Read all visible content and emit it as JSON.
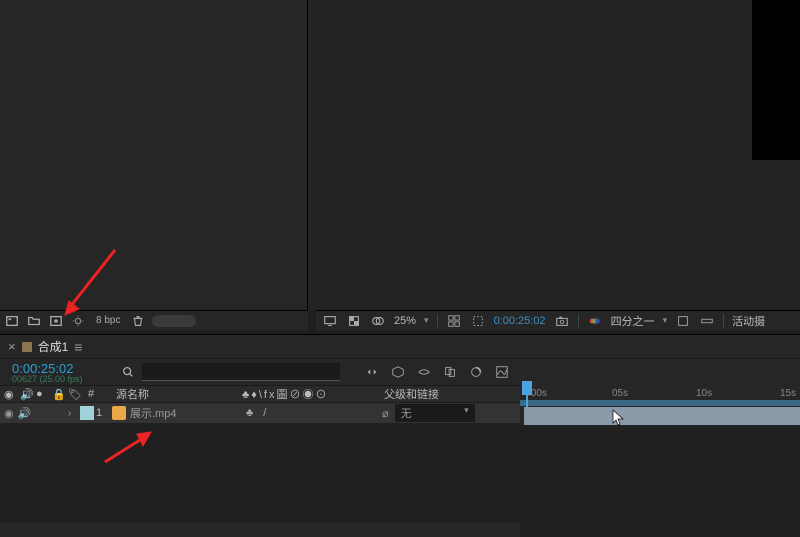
{
  "leftBar": {
    "bpc": "8 bpc"
  },
  "rightBar": {
    "zoom": "25%",
    "timecode": "0:00:25:02",
    "viewMode": "四分之一",
    "cameraLabel": "活动摄"
  },
  "timeline": {
    "tabName": "合成1",
    "timecode": "0:00:25:02",
    "fps": "00627 (25.00 fps)",
    "columns": {
      "sourceName": "源名称",
      "parentLink": "父级和链接",
      "switchSymbols": "♣♦\\fx圖⊘◉⊙",
      "tagHash": "#"
    },
    "layer": {
      "index": "1",
      "name": "展示.mp4",
      "parentValue": "无"
    },
    "ruler": {
      "t0": ":00s",
      "t1": "05s",
      "t2": "10s",
      "t3": "15s"
    }
  }
}
